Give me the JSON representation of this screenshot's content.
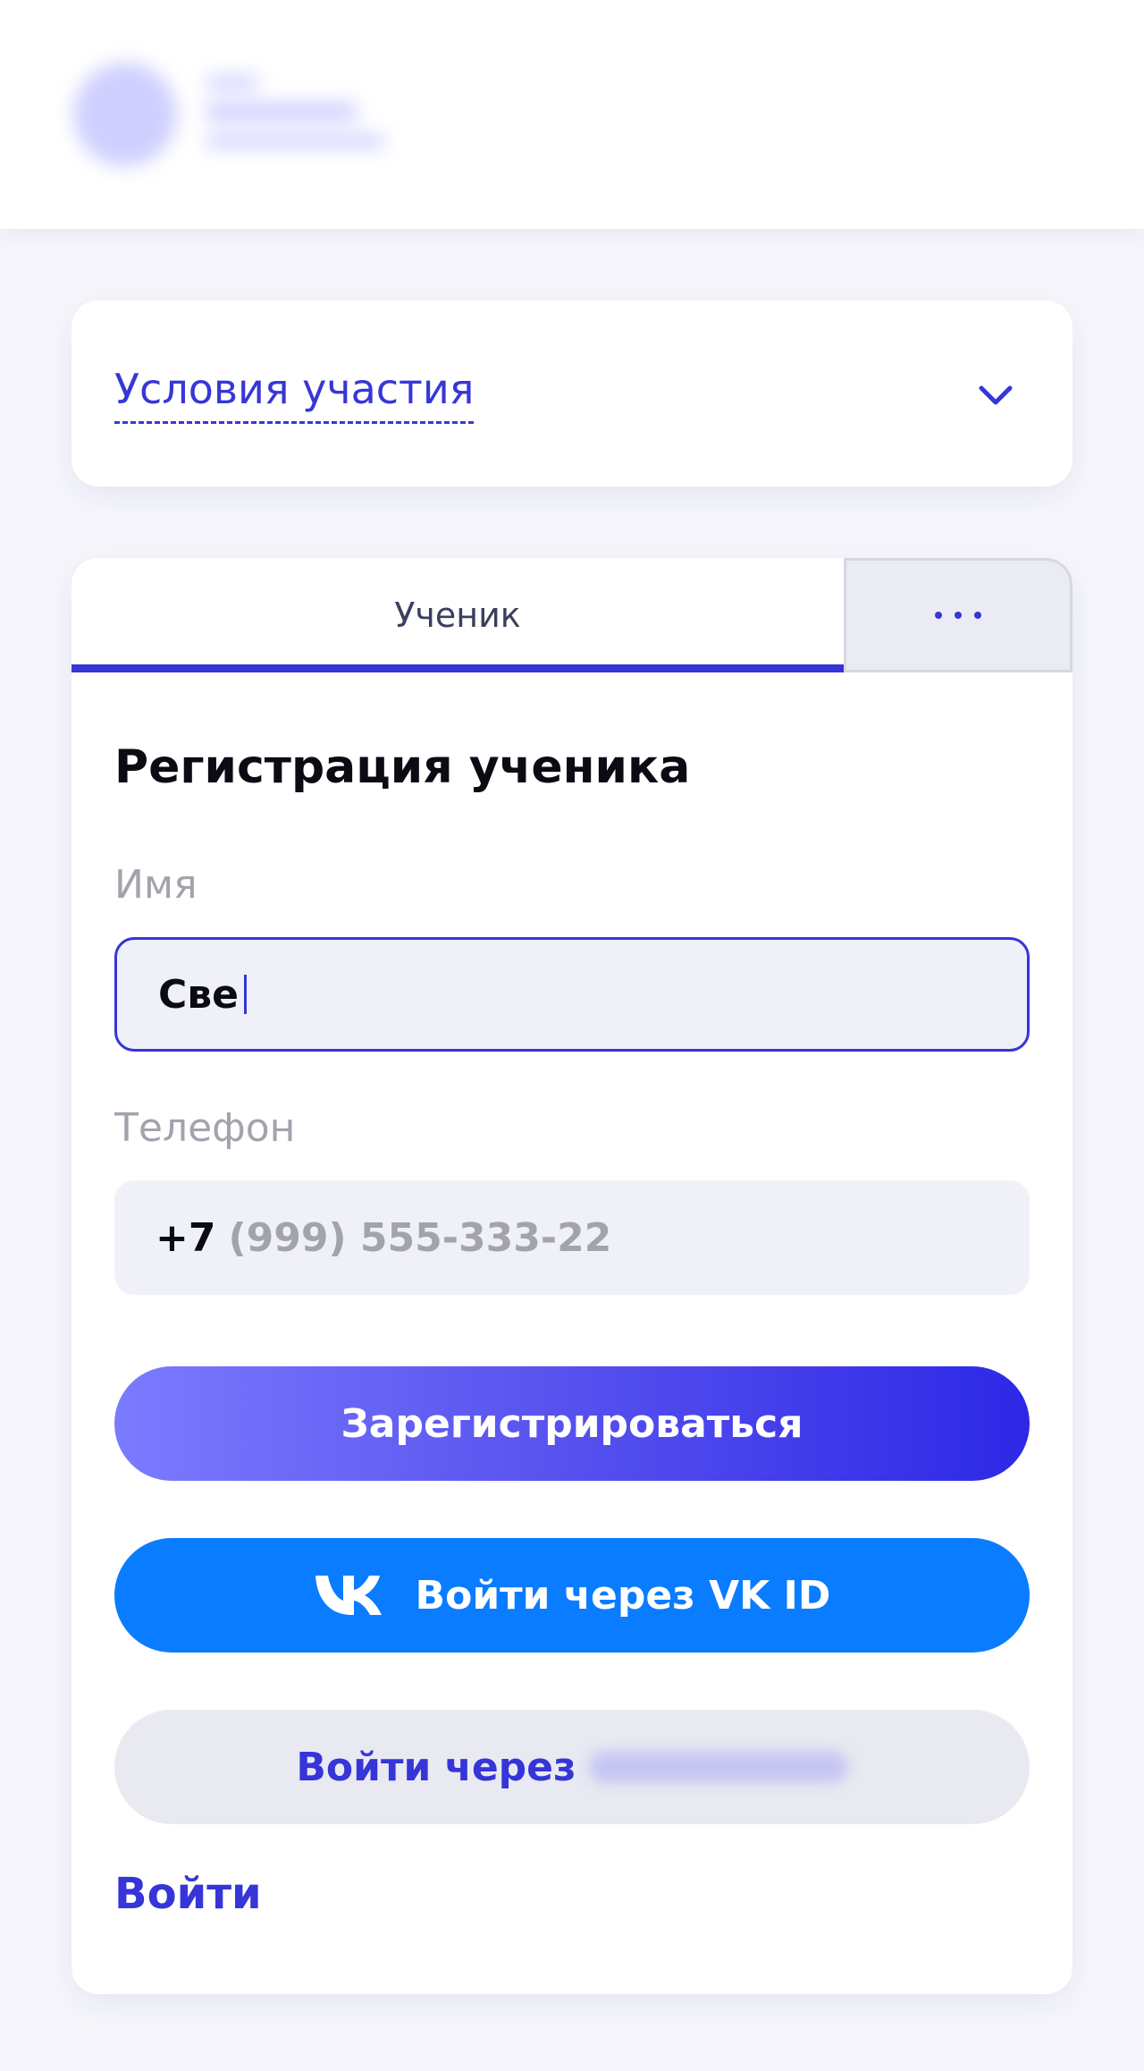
{
  "terms": {
    "label": "Условия участия"
  },
  "tabs": {
    "student": "Ученик"
  },
  "form": {
    "title": "Регистрация ученика",
    "name_label": "Имя",
    "name_value": "Све",
    "phone_label": "Телефон",
    "phone_prefix": "+7",
    "phone_placeholder": "(999) 555-333-22"
  },
  "buttons": {
    "register": "Зарегистрироваться",
    "vk": "Войти через VK ID",
    "other_prefix": "Войти через",
    "login": "Войти"
  },
  "icons": {
    "terms_toggle": "chevron-down-icon",
    "more_tabs": "more-dots-icon",
    "vk": "vk-logo-icon"
  },
  "colors": {
    "accent": "#3535d8",
    "vk_blue": "#0a7cff",
    "gradient_start": "#7b7bff",
    "gradient_end": "#2d28e6"
  }
}
